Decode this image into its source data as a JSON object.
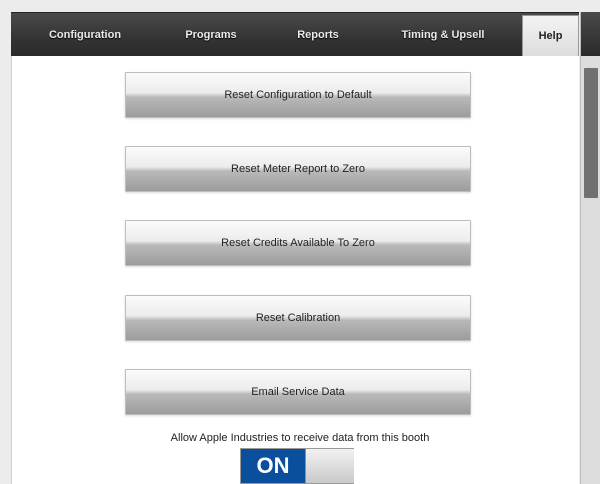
{
  "tabs": [
    {
      "label": "Configuration",
      "active": false
    },
    {
      "label": "Programs",
      "active": false
    },
    {
      "label": "Reports",
      "active": false
    },
    {
      "label": "Timing & Upsell",
      "active": false
    },
    {
      "label": "Help",
      "active": true
    }
  ],
  "buttons": [
    {
      "label": "Reset Configuration to Default"
    },
    {
      "label": "Reset Meter Report to Zero"
    },
    {
      "label": "Reset Credits Available To Zero"
    },
    {
      "label": "Reset Calibration"
    },
    {
      "label": "Email Service Data"
    }
  ],
  "data_sharing": {
    "caption": "Allow Apple Industries to receive data from this booth",
    "toggle_label": "ON",
    "enabled": true
  },
  "colors": {
    "tabbar": "#333333",
    "toggle_on": "#0a4f9b"
  }
}
